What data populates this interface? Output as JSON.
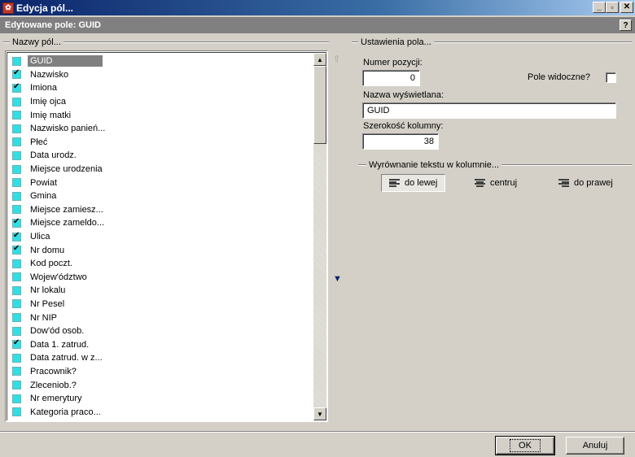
{
  "window": {
    "title": "Edycja pól...",
    "icon": "app-icon",
    "buttons": {
      "minimize": "_",
      "maximize": "🗗",
      "close": "✕"
    }
  },
  "subheader": {
    "title": "Edytowane pole: GUID",
    "help": "?"
  },
  "fields_group": {
    "caption": "Nazwy pól...",
    "items": [
      {
        "label": "GUID",
        "checked": false,
        "selected": true
      },
      {
        "label": "Nazwisko",
        "checked": true
      },
      {
        "label": "Imiona",
        "checked": true
      },
      {
        "label": "Imię ojca",
        "checked": false
      },
      {
        "label": "Imię matki",
        "checked": false
      },
      {
        "label": "Nazwisko panień...",
        "checked": false
      },
      {
        "label": "Płeć",
        "checked": false
      },
      {
        "label": "Data urodz.",
        "checked": false
      },
      {
        "label": "Miejsce urodzenia",
        "checked": false
      },
      {
        "label": "Powiat",
        "checked": false
      },
      {
        "label": "Gmina",
        "checked": false
      },
      {
        "label": "Miejsce zamiesz...",
        "checked": false
      },
      {
        "label": "Miejsce zameldo...",
        "checked": true
      },
      {
        "label": "Ulica",
        "checked": true
      },
      {
        "label": "Nr domu",
        "checked": true
      },
      {
        "label": "Kod poczt.",
        "checked": false
      },
      {
        "label": "Wojew'ództwo",
        "checked": false
      },
      {
        "label": "Nr lokalu",
        "checked": false
      },
      {
        "label": "Nr Pesel",
        "checked": false
      },
      {
        "label": "Nr NIP",
        "checked": false
      },
      {
        "label": "Dow'ód osob.",
        "checked": false
      },
      {
        "label": "Data 1. zatrud.",
        "checked": true
      },
      {
        "label": "Data zatrud. w z...",
        "checked": false
      },
      {
        "label": "Pracownik?",
        "checked": false
      },
      {
        "label": "Zleceniob.?",
        "checked": false
      },
      {
        "label": "Nr emerytury",
        "checked": false
      },
      {
        "label": "Kategoria praco...",
        "checked": false
      }
    ]
  },
  "settings": {
    "caption": "Ustawienia pola...",
    "position_label": "Numer pozycji:",
    "position_value": "0",
    "visible_label": "Pole widoczne?",
    "visible_checked": false,
    "display_name_label": "Nazwa wyświetlana:",
    "display_name_value": "GUID",
    "width_label": "Szerokość kolumny:",
    "width_value": "38",
    "alignment_caption": "Wyrównanie tekstu w kolumnie...",
    "alignment_options": [
      {
        "label": "do lewej",
        "pressed": true
      },
      {
        "label": "centruj",
        "pressed": false
      },
      {
        "label": "do prawej",
        "pressed": false
      }
    ]
  },
  "buttons": {
    "ok": "OK",
    "cancel": "Anuluj"
  },
  "colors": {
    "titlebar": "#0a246a",
    "checkbox_fill": "#2ee0e6",
    "selection": "#808080"
  }
}
